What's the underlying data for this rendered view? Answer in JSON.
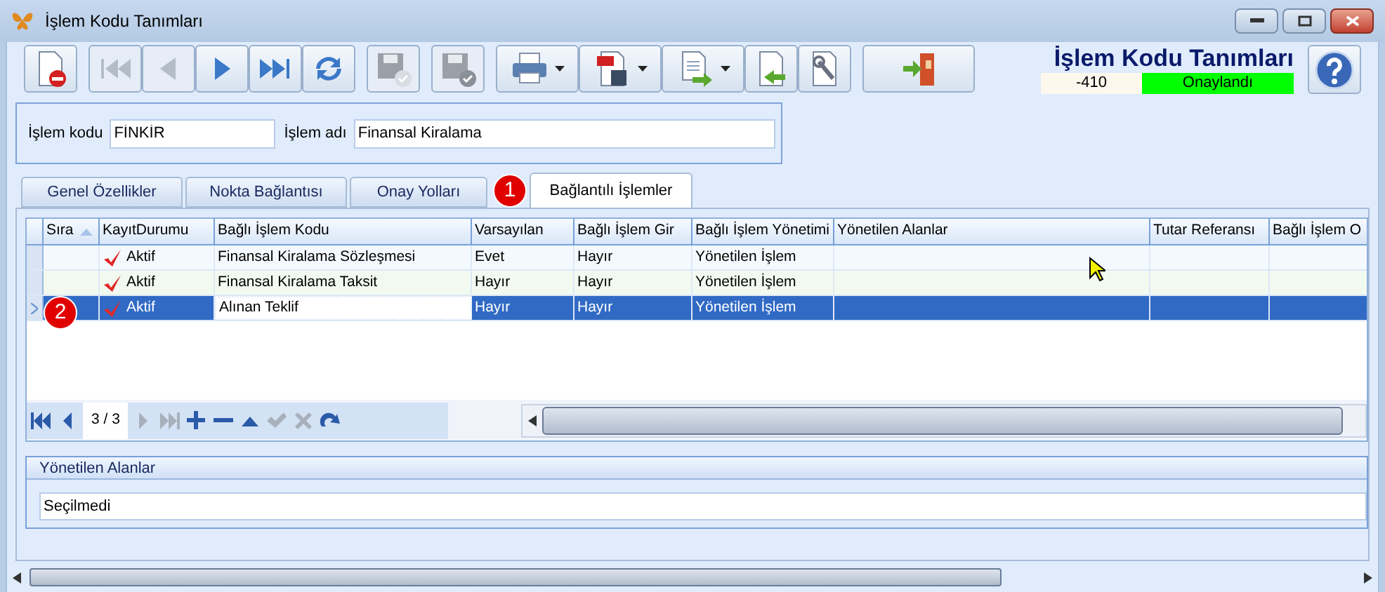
{
  "window": {
    "title": "İşlem Kodu Tanımları"
  },
  "toolbar": [
    {
      "kind": "delete",
      "disabled": false,
      "dropdown": false
    },
    {
      "kind": "first",
      "disabled": true,
      "dropdown": false
    },
    {
      "kind": "prev",
      "disabled": true,
      "dropdown": false
    },
    {
      "kind": "next",
      "disabled": false,
      "dropdown": false
    },
    {
      "kind": "last",
      "disabled": false,
      "dropdown": false
    },
    {
      "kind": "refresh",
      "disabled": false,
      "dropdown": false
    },
    {
      "kind": "save",
      "disabled": true,
      "dropdown": false
    },
    {
      "kind": "discard",
      "disabled": true,
      "dropdown": false
    },
    {
      "kind": "print",
      "disabled": false,
      "dropdown": true
    },
    {
      "kind": "pdf",
      "disabled": false,
      "dropdown": true
    },
    {
      "kind": "export",
      "disabled": false,
      "dropdown": true
    },
    {
      "kind": "import",
      "disabled": false,
      "dropdown": false
    },
    {
      "kind": "tools",
      "disabled": false,
      "dropdown": false
    },
    {
      "kind": "exit",
      "disabled": false,
      "dropdown": false
    }
  ],
  "header": {
    "title": "İşlem Kodu Tanımları",
    "code": "-410",
    "status": "Onaylandı"
  },
  "form": {
    "fields": [
      {
        "label": "İşlem kodu",
        "value": "FİNKİR"
      },
      {
        "label": "İşlem adı",
        "value": "Finansal Kiralama"
      }
    ]
  },
  "tabs": [
    {
      "label": "Genel Özellikler",
      "selected": false
    },
    {
      "label": "Nokta Bağlantısı",
      "selected": false
    },
    {
      "label": "Onay Yolları",
      "selected": false
    },
    {
      "label": "Bağlantılı İşlemler",
      "selected": true
    }
  ],
  "grid": {
    "columns": [
      "Sıra",
      "KayıtDurumu",
      "Bağlı İşlem Kodu",
      "Varsayılan",
      "Bağlı İşlem Gir",
      "Bağlı İşlem Yönetimi",
      "Yönetilen Alanlar",
      "Tutar Referansı",
      "Bağlı İşlem O"
    ],
    "rows": [
      {
        "checked": true,
        "cells": [
          "",
          "Aktif",
          "Finansal Kiralama Sözleşmesi",
          "Evet",
          "Hayır",
          "Yönetilen İşlem",
          "",
          "",
          ""
        ],
        "selected": false
      },
      {
        "checked": true,
        "cells": [
          "",
          "Aktif",
          "Finansal Kiralama Taksit",
          "Hayır",
          "Hayır",
          "Yönetilen İşlem",
          "",
          "",
          ""
        ],
        "selected": false
      },
      {
        "checked": true,
        "cells": [
          "",
          "Aktif",
          "Alınan Teklif",
          "Hayır",
          "Hayır",
          "Yönetilen İşlem",
          "",
          "",
          ""
        ],
        "selected": true
      }
    ]
  },
  "navigator": {
    "position": "3 / 3",
    "buttons": [
      {
        "kind": "first",
        "disabled": false
      },
      {
        "kind": "prev",
        "disabled": false
      },
      {
        "kind": "next",
        "disabled": true
      },
      {
        "kind": "last",
        "disabled": true
      },
      {
        "kind": "add",
        "disabled": false
      },
      {
        "kind": "remove",
        "disabled": false
      },
      {
        "kind": "up",
        "disabled": false
      },
      {
        "kind": "accept",
        "disabled": true
      },
      {
        "kind": "cancel",
        "disabled": true
      },
      {
        "kind": "redo",
        "disabled": false
      }
    ]
  },
  "details": {
    "title": "Yönetilen Alanlar",
    "value": "Seçilmedi"
  },
  "annotations": [
    {
      "text": "1"
    },
    {
      "text": "2"
    }
  ]
}
